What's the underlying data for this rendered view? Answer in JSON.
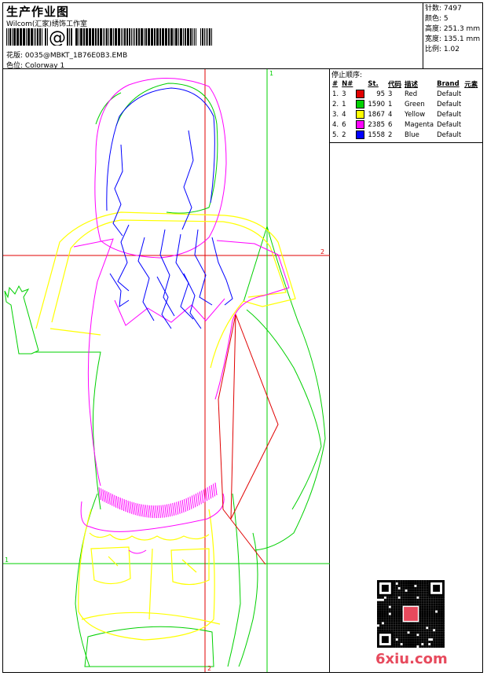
{
  "header": {
    "title": "生产作业图",
    "company": "Wilcom(汇家)绣饰工作室",
    "design_label": "花版:",
    "design_file": "0035@MBKT_1B76E0B3.EMB",
    "colorway_label": "色位:",
    "colorway_value": "Colorway 1"
  },
  "stats": {
    "stitches_label": "针数:",
    "stitches": "7497",
    "colors_label": "颜色:",
    "colors": "5",
    "height_label": "高度:",
    "height": "251.3 mm",
    "width_label": "宽度:",
    "width": "135.1 mm",
    "scale_label": "比例:",
    "scale": "1.02"
  },
  "stop_sequence": {
    "title": "停止顺序:",
    "headers": [
      "#",
      "N#",
      "St.",
      "代码",
      "描述",
      "Brand",
      "元素"
    ],
    "rows": [
      {
        "idx": "1.",
        "n": "3",
        "color": "#e00000",
        "st": "95",
        "code": "3",
        "desc": "Red",
        "brand": "Default"
      },
      {
        "idx": "2.",
        "n": "1",
        "color": "#00d000",
        "st": "1590",
        "code": "1",
        "desc": "Green",
        "brand": "Default"
      },
      {
        "idx": "3.",
        "n": "4",
        "color": "#ffff00",
        "st": "1867",
        "code": "4",
        "desc": "Yellow",
        "brand": "Default"
      },
      {
        "idx": "4.",
        "n": "6",
        "color": "#ff00ff",
        "st": "2385",
        "code": "6",
        "desc": "Magenta",
        "brand": "Default"
      },
      {
        "idx": "5.",
        "n": "2",
        "color": "#0000ff",
        "st": "1558",
        "code": "2",
        "desc": "Blue",
        "brand": "Default"
      }
    ]
  },
  "guides": {
    "h1_label": "1",
    "h2_label": "2",
    "v1_label": "1",
    "v2_label": "2"
  },
  "watermark": "6xiu.com",
  "colors": {
    "red": "#e00000",
    "green": "#00d000",
    "yellow": "#ffff00",
    "magenta": "#ff00ff",
    "blue": "#0000ff"
  }
}
